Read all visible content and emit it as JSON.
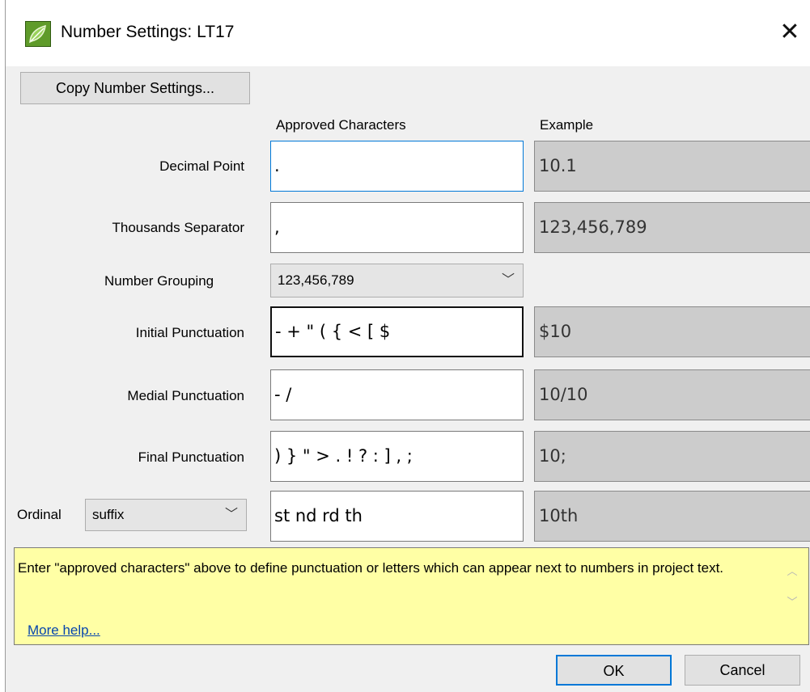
{
  "window": {
    "title": "Number Settings: LT17",
    "app_icon": "leaf-icon",
    "close_glyph": "✕"
  },
  "toolbar": {
    "copy_label": "Copy Number Settings..."
  },
  "columns": {
    "approved": "Approved Characters",
    "example": "Example"
  },
  "rows": {
    "decimal": {
      "label": "Decimal Point",
      "value": ".",
      "example": "10.1"
    },
    "thousands": {
      "label": "Thousands Separator",
      "value": ",",
      "example": "123,456,789"
    },
    "grouping": {
      "label": "Number Grouping",
      "selected": "123,456,789"
    },
    "initial": {
      "label": "Initial Punctuation",
      "value": "- + \" ( { < [ $",
      "example": "$10"
    },
    "medial": {
      "label": "Medial Punctuation",
      "value": "- /",
      "example": "10/10"
    },
    "final": {
      "label": "Final Punctuation",
      "value": ") } \" > . ! ? : ] , ;",
      "example": "10;"
    },
    "ordinal": {
      "label": "Ordinal",
      "position": "suffix",
      "value": "st nd rd th",
      "example": "10th"
    }
  },
  "help": {
    "text": "Enter \"approved characters\" above to define punctuation or letters which can appear next to numbers in project text.",
    "link": "More help..."
  },
  "buttons": {
    "ok": "OK",
    "cancel": "Cancel"
  },
  "colors": {
    "accent": "#0078d7",
    "help_background": "#ffffa5",
    "example_background": "#cccccc"
  }
}
